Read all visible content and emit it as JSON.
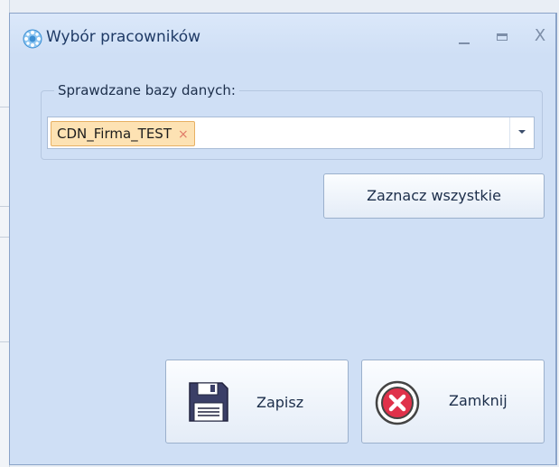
{
  "window": {
    "title": "Wybór pracowników",
    "controls": {
      "minimize": "_",
      "maximize": "□",
      "close": "X"
    }
  },
  "group": {
    "legend": "Sprawdzane bazy danych:",
    "selected_tokens": [
      {
        "label": "CDN_Firma_TEST",
        "remove": "×"
      }
    ]
  },
  "buttons": {
    "select_all": "Zaznacz wszystkie",
    "save": "Zapisz",
    "close": "Zamknij"
  },
  "icons": {
    "app": "gear-icon",
    "save": "floppy-disk-icon",
    "close": "close-circle-icon"
  },
  "colors": {
    "window_bg": "#cfdff5",
    "title_text": "#1f3a66",
    "token_bg": "#fde2b3",
    "token_border": "#e7b063",
    "close_icon_red": "#e0314a"
  }
}
